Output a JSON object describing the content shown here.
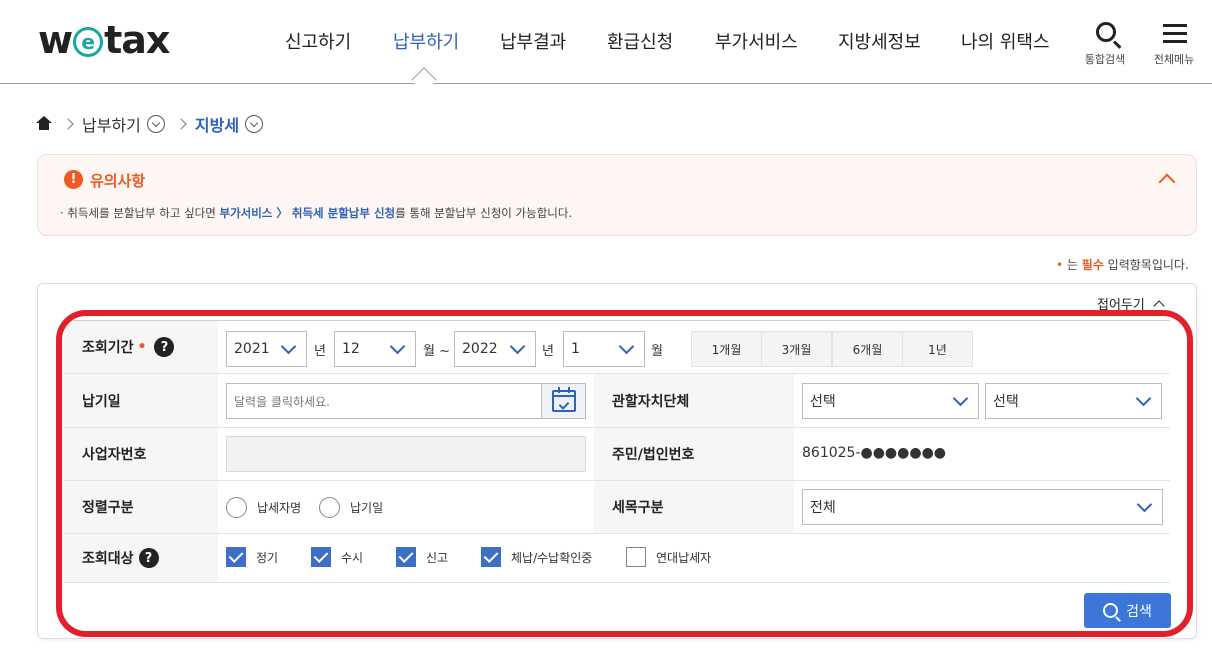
{
  "logo": {
    "prefix": "w",
    "e": "e",
    "suffix": "tax"
  },
  "nav": {
    "items": [
      "신고하기",
      "납부하기",
      "납부결과",
      "환급신청",
      "부가서비스",
      "지방세정보",
      "나의 위택스"
    ],
    "active": "납부하기",
    "search_label": "통합검색",
    "menu_label": "전체메뉴"
  },
  "breadcrumb": {
    "level1": "납부하기",
    "level2": "지방세"
  },
  "notice": {
    "title": "유의사항",
    "line_prefix": "· 취득세를 분할납부 하고 싶다면 ",
    "link_text": "부가서비스 〉 취득세 분할납부 신청",
    "line_suffix": "를 통해 분할납부 신청이 가능합니다."
  },
  "required_note": {
    "dot": "•",
    "prefix": " 는 ",
    "bold": "필수",
    "suffix": " 입력항목입니다."
  },
  "panel": {
    "collapse_label": "접어두기"
  },
  "form": {
    "period": {
      "label": "조회기간",
      "req_dot": "•",
      "help": "?",
      "from_year": "2021",
      "year_unit": "년",
      "from_month": "12",
      "month_unit_tilde": "월 ~",
      "to_year": "2022",
      "to_year_unit": "년",
      "to_month": "1",
      "to_month_unit": "월",
      "quick": [
        "1개월",
        "3개월",
        "6개월",
        "1년"
      ]
    },
    "pay_date": {
      "label": "납기일",
      "placeholder": "달력을 클릭하세요."
    },
    "jurisdiction": {
      "label": "관할자치단체",
      "sido": "선택",
      "sigungu": "선택"
    },
    "business_no": {
      "label": "사업자번호",
      "value": ""
    },
    "resident_no": {
      "label": "주민/법인번호",
      "value": "861025-●●●●●●●"
    },
    "sort": {
      "label": "정렬구분",
      "options": [
        "납세자명",
        "납기일"
      ]
    },
    "tax_item": {
      "label": "세목구분",
      "value": "전체"
    },
    "target": {
      "label": "조회대상",
      "help": "?",
      "options": [
        {
          "label": "정기",
          "checked": true
        },
        {
          "label": "수시",
          "checked": true
        },
        {
          "label": "신고",
          "checked": true
        },
        {
          "label": "체납/수납확인중",
          "checked": true
        },
        {
          "label": "연대납세자",
          "checked": false
        }
      ]
    },
    "search_button": "검색"
  },
  "colors": {
    "accent": "#2f63b8",
    "warning": "#ee5a24",
    "highlight": "#e2202c",
    "button": "#3b76d8"
  }
}
